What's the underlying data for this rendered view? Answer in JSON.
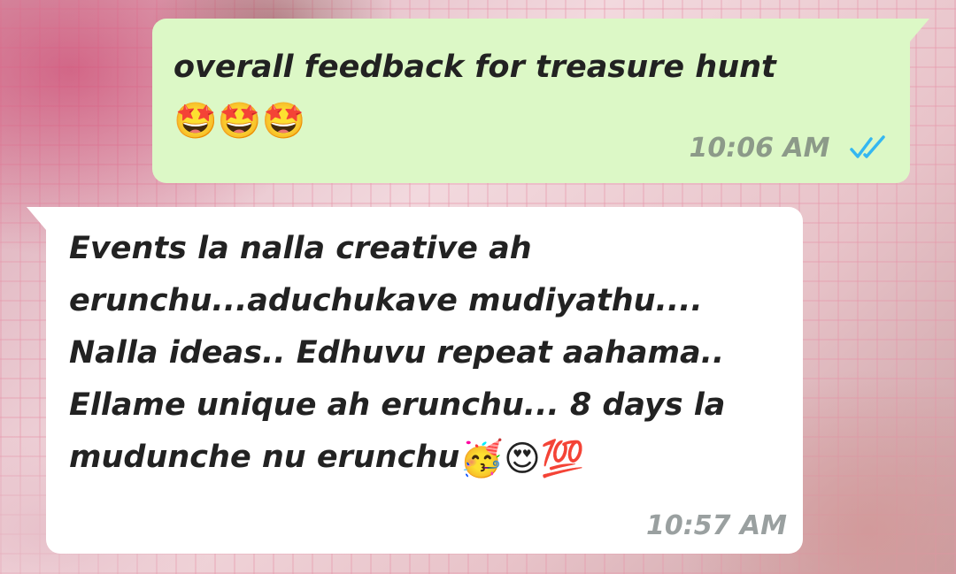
{
  "messages": [
    {
      "direction": "outgoing",
      "text": "overall feedback for treasure hunt",
      "emojis": "🤩🤩🤩",
      "time": "10:06 AM",
      "status_icon": "double-check-read-icon",
      "status_color": "#34b7f1"
    },
    {
      "direction": "incoming",
      "text": "Events la nalla creative ah erunchu...aduchukave mudiyathu.... Nalla ideas.. Edhuvu repeat aahama.. Ellame unique ah erunchu... 8 days la mudunche nu erunchu",
      "emojis": "🥳😍💯",
      "time": "10:57 AM"
    }
  ],
  "colors": {
    "outgoing_bubble": "#dcf8c6",
    "incoming_bubble": "#ffffff"
  }
}
